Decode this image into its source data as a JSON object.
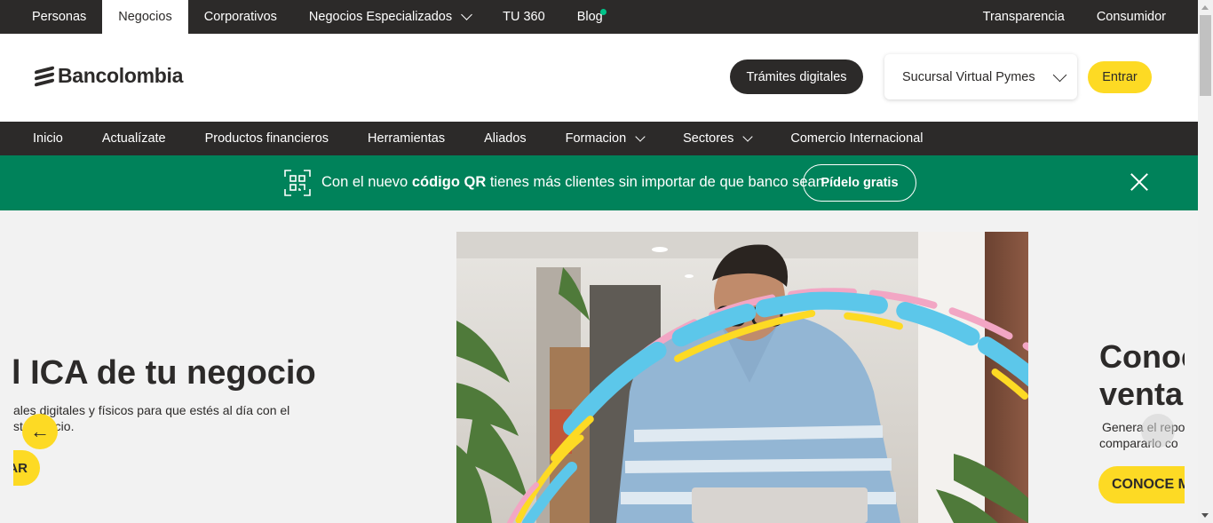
{
  "topbar": {
    "left_items": [
      {
        "label": "Personas",
        "active": false
      },
      {
        "label": "Negocios",
        "active": true
      },
      {
        "label": "Corporativos",
        "active": false
      },
      {
        "label": "Negocios Especializados",
        "active": false,
        "dropdown": true
      },
      {
        "label": "TU 360",
        "active": false
      },
      {
        "label": "Blog",
        "active": false,
        "notification_dot": true
      }
    ],
    "right_items": [
      "Transparencia",
      "Consumidor"
    ]
  },
  "header": {
    "logo_text": "Bancolombia",
    "tramites_label": "Trámites digitales",
    "sucursal_label": "Sucursal Virtual Pymes",
    "entrar_label": "Entrar"
  },
  "navbar": {
    "items": [
      {
        "label": "Inicio"
      },
      {
        "label": "Actualízate"
      },
      {
        "label": "Productos financieros"
      },
      {
        "label": "Herramientas"
      },
      {
        "label": "Aliados"
      },
      {
        "label": "Formacion",
        "dropdown": true
      },
      {
        "label": "Sectores",
        "dropdown": true
      },
      {
        "label": "Comercio Internacional"
      }
    ]
  },
  "banner": {
    "text_before": "Con el nuevo ",
    "text_bold": "código QR",
    "text_after": " tienes más clientes sin importar de que banco sean.",
    "cta_label": "Pídelo gratis",
    "background_color": "#00825a"
  },
  "carousel": {
    "left_slide": {
      "title": "l ICA de tu negocio",
      "desc_line1": "ales digitales y físicos para que estés al día con el",
      "desc_line2": "st  omercio.",
      "button_label": "AR"
    },
    "right_slide": {
      "title_line1": "Conoc",
      "title_line2": "venta",
      "desc_line1": "Genera el repo",
      "desc_line2": "compararlo co",
      "button_label": "CONOCE M"
    },
    "prev_icon": "←"
  },
  "colors": {
    "dark": "#2c2a29",
    "yellow": "#fdda24",
    "green": "#00825a",
    "green_dot": "#00c389"
  }
}
